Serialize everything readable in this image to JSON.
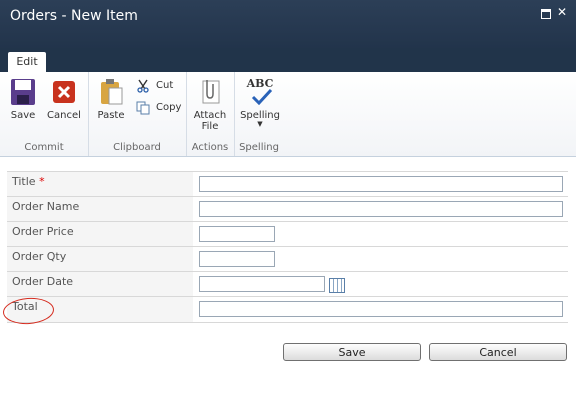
{
  "window": {
    "title": "Orders - New Item"
  },
  "tabs": [
    {
      "label": "Edit"
    }
  ],
  "ribbon": {
    "groups": [
      {
        "label": "Commit",
        "buttons": [
          {
            "label": "Save",
            "icon": "floppy-disk-icon"
          },
          {
            "label": "Cancel",
            "icon": "red-x-icon"
          }
        ]
      },
      {
        "label": "Clipboard",
        "buttons": [
          {
            "label": "Paste",
            "icon": "clipboard-icon"
          },
          {
            "label": "Cut",
            "icon": "scissors-icon"
          },
          {
            "label": "Copy",
            "icon": "copy-icon"
          }
        ]
      },
      {
        "label": "Actions",
        "buttons": [
          {
            "label": "Attach File",
            "label_line1": "Attach",
            "label_line2": "File",
            "icon": "paperclip-icon"
          }
        ]
      },
      {
        "label": "Spelling",
        "buttons": [
          {
            "label": "Spelling",
            "icon": "abc-check-icon",
            "badge": "ABC"
          }
        ]
      }
    ]
  },
  "form": {
    "required_marker": "*",
    "fields": [
      {
        "label": "Title",
        "required": true,
        "value": ""
      },
      {
        "label": "Order Name",
        "value": ""
      },
      {
        "label": "Order Price",
        "value": ""
      },
      {
        "label": "Order Qty",
        "value": ""
      },
      {
        "label": "Order Date",
        "value": ""
      },
      {
        "label": "Total",
        "value": ""
      }
    ]
  },
  "actions": {
    "save_label": "Save",
    "cancel_label": "Cancel"
  },
  "colors": {
    "titlebar": "#22344b",
    "annotation": "#d52b1e",
    "required": "#dd0000"
  }
}
